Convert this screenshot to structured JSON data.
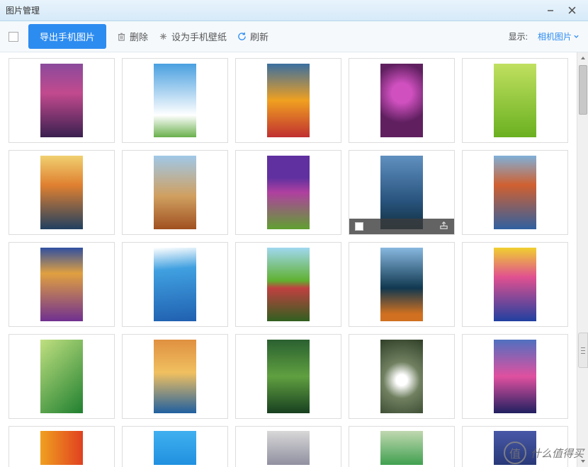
{
  "titlebar": {
    "title": "图片管理"
  },
  "toolbar": {
    "export_label": "导出手机图片",
    "delete_label": "删除",
    "set_wallpaper_label": "设为手机壁纸",
    "refresh_label": "刷新",
    "display_label": "显示:",
    "display_value": "相机图片"
  },
  "watermark": {
    "char": "值",
    "text": "什么值得买"
  },
  "grid": {
    "rows": [
      [
        "g1",
        "g2",
        "g3",
        "g4",
        "g5"
      ],
      [
        "g6",
        "g7",
        "g8",
        "g9",
        "g10"
      ],
      [
        "g11",
        "g12",
        "g13",
        "g14",
        "g15"
      ],
      [
        "g16",
        "g17",
        "g18",
        "g19",
        "g20"
      ],
      [
        "g21",
        "g22",
        "g23",
        "g24",
        "g25"
      ]
    ],
    "hovered": [
      1,
      3
    ]
  }
}
